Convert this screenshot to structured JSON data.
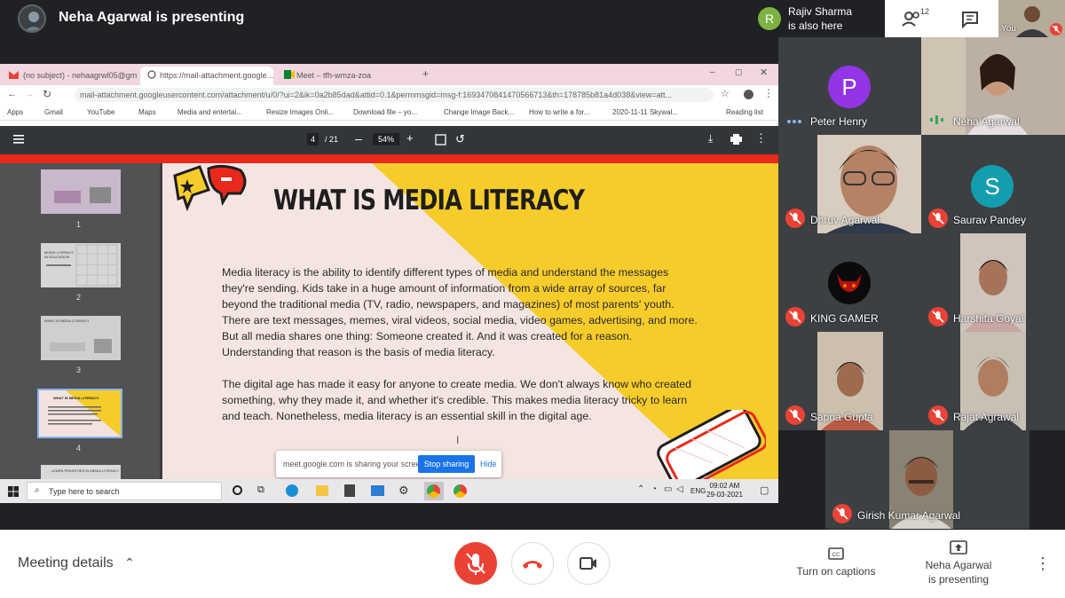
{
  "header": {
    "presenting_title": "Neha Agarwal is presenting",
    "also_here_initial": "R",
    "also_here_name": "Rajiv Sharma",
    "also_here_status": "is also here",
    "people_count": "12",
    "you_label": "You"
  },
  "browser": {
    "tabs": [
      "(no subject) - nehaagrwl05@gm",
      "https://mail-attachment.google...",
      "Meet – tfh-wmza-zoa"
    ],
    "url": "mail-attachment.googleusercontent.com/attachment/u/0/?ui=2&ik=0a2b85dad&attid=0.1&permmsgid=msg-f:1693470841470566713&th=178785b81a4d038&view=att...",
    "bookmarks": [
      "Apps",
      "Gmail",
      "YouTube",
      "Maps",
      "Media and entertai...",
      "Resize Images Onli...",
      "Download file – yo...",
      "Change Image Back...",
      "How to write a for...",
      "2020-11-11 Skywal...",
      "Reading list"
    ]
  },
  "pdf": {
    "page_current": "4",
    "page_total": "/ 21",
    "zoom": "54%",
    "thumb_labels": [
      "1",
      "2",
      "3",
      "4"
    ],
    "thumb_texts": [
      "",
      "MIXED LITERACY IN EDUCATION",
      "WHAT IS MEDIA LITERACY",
      "WHAT IS MEDIA LITERACY",
      "LEARN PRIORITIES IN MEDIA LITERACY"
    ]
  },
  "slide": {
    "title": "WHAT IS MEDIA LITERACY",
    "para1": "Media literacy is the ability to identify different types of media and understand the messages they're sending. Kids take in a huge amount of information from a wide array of sources, far beyond the traditional media (TV, radio, newspapers, and magazines) of most parents' youth. There are text messages, memes, viral videos, social media, video games, advertising, and more. But all media shares one thing: Someone created it. And it was created for a reason. Understanding that reason is the basis of media literacy.",
    "para2": "The digital age has made it easy for anyone to create media. We don't always know who created something, why they made it, and whether it's credible. This makes media literacy tricky to learn and teach. Nonetheless, media literacy is an essential skill in the digital age."
  },
  "sharing_bar": {
    "message": "meet.google.com is sharing your screen.",
    "stop_label": "Stop sharing",
    "hide_label": "Hide"
  },
  "taskbar": {
    "search_placeholder": "Type here to search",
    "lang": "ENG",
    "time": "09:02 AM",
    "date": "29-03-2021"
  },
  "participants": [
    {
      "name": "Peter Henry",
      "initial": "P",
      "color": "#9334e6"
    },
    {
      "name": "Neha Agarwal"
    },
    {
      "name": "Dhruv Agarwal"
    },
    {
      "name": "Saurav Pandey",
      "initial": "S",
      "color": "#129eaf"
    },
    {
      "name": "KING GAMER"
    },
    {
      "name": "Harshita Goyal"
    },
    {
      "name": "Sapna Gupta"
    },
    {
      "name": "Rajat Agrawal"
    },
    {
      "name": "Girish Kumar Agarwal"
    }
  ],
  "bottom": {
    "meeting_details": "Meeting details",
    "captions_label": "Turn on captions",
    "presenting_line1": "Neha Agarwal",
    "presenting_line2": "is presenting"
  },
  "colors": {
    "mic_off": "#ea4335",
    "slide_yellow": "#f6cc2a",
    "accent_blue": "#1a73e8"
  }
}
